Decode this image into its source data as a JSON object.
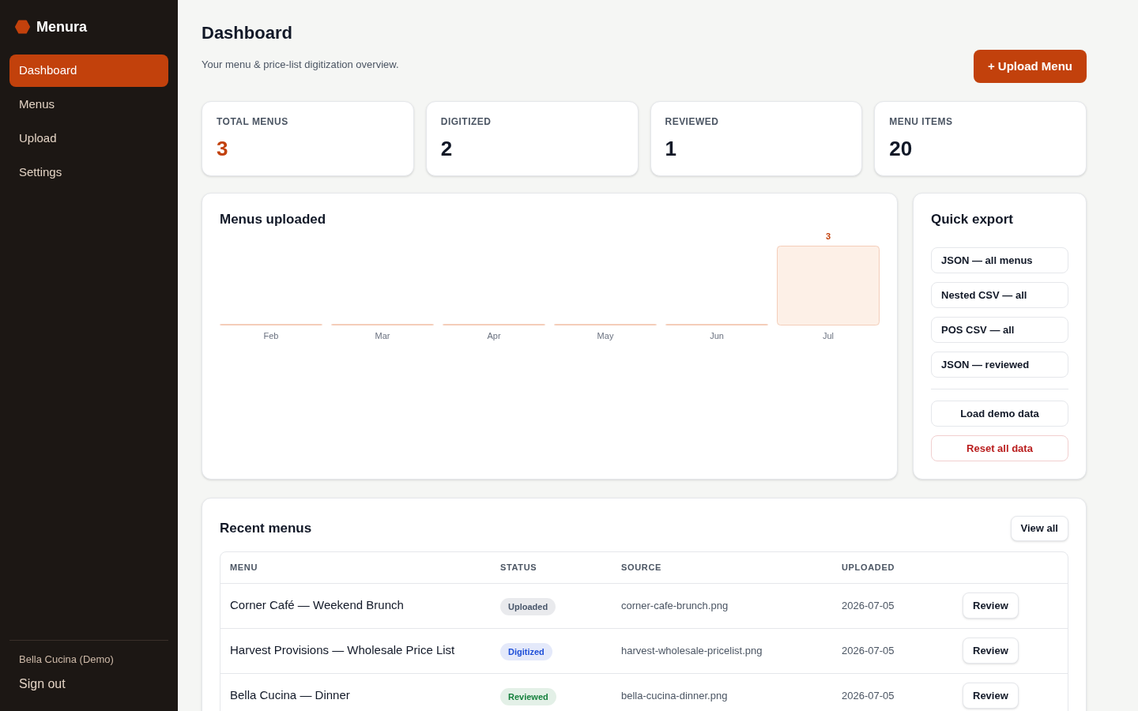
{
  "sidebar": {
    "brand": "Menura",
    "nav": [
      {
        "label": "Dashboard",
        "selected": true
      },
      {
        "label": "Menus",
        "selected": false
      },
      {
        "label": "Upload",
        "selected": false
      },
      {
        "label": "Settings",
        "selected": false
      }
    ],
    "account": "Bella Cucina (Demo)",
    "sign_out": "Sign out"
  },
  "header": {
    "title": "Dashboard",
    "subtitle": "Your menu & price-list digitization overview.",
    "upload_button": "+ Upload Menu"
  },
  "stats": [
    {
      "label": "TOTAL MENUS",
      "value": "3",
      "color": "#c2410c"
    },
    {
      "label": "DIGITIZED",
      "value": "2",
      "color": "#111827"
    },
    {
      "label": "REVIEWED",
      "value": "1",
      "color": "#111827"
    },
    {
      "label": "MENU ITEMS",
      "value": "20",
      "color": "#111827"
    }
  ],
  "chart_panel": {
    "title": "Menus uploaded",
    "chart_data": {
      "type": "bar",
      "categories": [
        "Feb",
        "Mar",
        "Apr",
        "May",
        "Jun",
        "Jul"
      ],
      "values": [
        0,
        0,
        0,
        0,
        0,
        3
      ],
      "value_labels": [
        null,
        null,
        null,
        null,
        null,
        "3"
      ]
    }
  },
  "quick_export": {
    "title": "Quick export",
    "exports": [
      "JSON — all menus",
      "Nested CSV — all",
      "POS CSV — all",
      "JSON — reviewed"
    ],
    "actions": [
      {
        "label": "Load demo data",
        "kind": "neutral"
      },
      {
        "label": "Reset all data",
        "kind": "danger"
      }
    ]
  },
  "recent_menus": {
    "title": "Recent menus",
    "view_all": "View all",
    "columns": [
      "MENU",
      "STATUS",
      "SOURCE",
      "UPLOADED"
    ],
    "rows": [
      {
        "menu": "Corner Café — Weekend Brunch",
        "status": {
          "label": "Uploaded",
          "color": "#475569"
        },
        "source": "corner-cafe-brunch.png",
        "uploaded": "2026-07-05",
        "action": "Review"
      },
      {
        "menu": "Harvest Provisions — Wholesale Price List",
        "status": {
          "label": "Digitized",
          "color": "#1d4ed8"
        },
        "source": "harvest-wholesale-pricelist.png",
        "uploaded": "2026-07-05",
        "action": "Review"
      },
      {
        "menu": "Bella Cucina — Dinner",
        "status": {
          "label": "Reviewed",
          "color": "#15803d"
        },
        "source": "bella-cucina-dinner.png",
        "uploaded": "2026-07-05",
        "action": "Review"
      }
    ]
  }
}
